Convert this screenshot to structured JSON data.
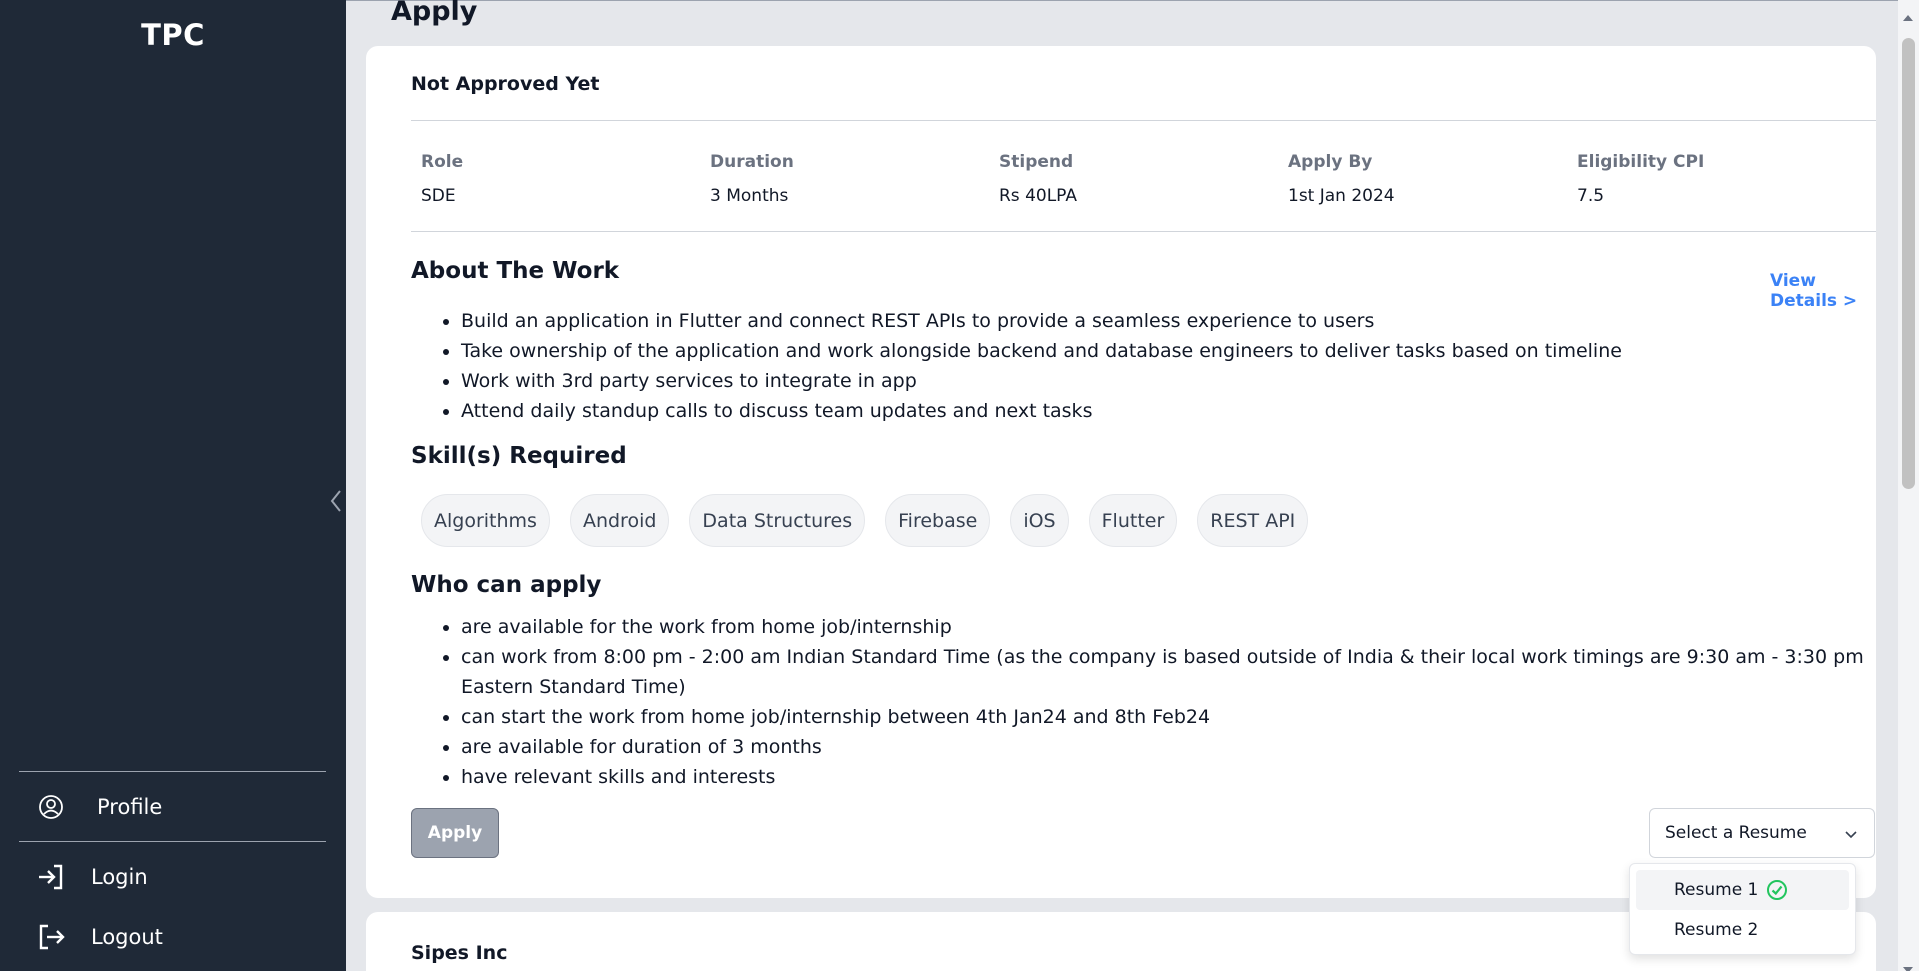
{
  "sidebar": {
    "brand": "TPC",
    "items": [
      {
        "label": "Profile",
        "icon": "user-circle-icon"
      },
      {
        "label": "Login",
        "icon": "login-icon"
      },
      {
        "label": "Logout",
        "icon": "logout-icon"
      }
    ]
  },
  "page": {
    "title": "Apply"
  },
  "job": {
    "status": "Not Approved Yet",
    "info": [
      {
        "label": "Role",
        "value": "SDE"
      },
      {
        "label": "Duration",
        "value": "3 Months"
      },
      {
        "label": "Stipend",
        "value": "Rs 40LPA"
      },
      {
        "label": "Apply By",
        "value": "1st Jan 2024"
      },
      {
        "label": "Eligibility CPI",
        "value": "7.5"
      }
    ],
    "about_heading": "About The Work",
    "view_details": "View Details >",
    "about_items": [
      "Build an application in Flutter and connect REST APIs to provide a seamless experience to users",
      "Take ownership of the application and work alongside backend and database engineers to deliver tasks based on timeline",
      "Work with 3rd party services to integrate in app",
      "Attend daily standup calls to discuss team updates and next tasks"
    ],
    "skills_heading": "Skill(s) Required",
    "skills": [
      "Algorithms",
      "Android",
      "Data Structures",
      "Firebase",
      "iOS",
      "Flutter",
      "REST API"
    ],
    "who_heading": "Who can apply",
    "who_items": [
      "are available for the work from home job/internship",
      "can work from 8:00 pm - 2:00 am Indian Standard Time (as the company is based outside of India & their local work timings are 9:30 am - 3:30 pm Eastern Standard Time)",
      "can start the work from home job/internship between 4th Jan24 and 8th Feb24",
      "are available for duration of 3 months",
      "have relevant skills and interests"
    ],
    "apply_label": "Apply",
    "resume_select": {
      "placeholder": "Select a Resume",
      "options": [
        "Resume 1",
        "Resume 2"
      ],
      "selected": "Resume 1"
    }
  },
  "next_card": {
    "company": "Sipes Inc"
  },
  "colors": {
    "sidebar_bg": "#1f2937",
    "link": "#3b82f6",
    "check": "#22c55e"
  }
}
